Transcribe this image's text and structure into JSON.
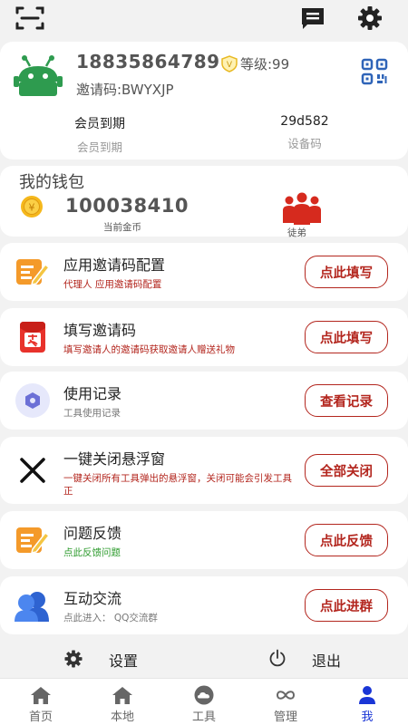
{
  "header": {
    "icons": [
      "scan-icon",
      "message-icon",
      "settings-icon"
    ]
  },
  "profile": {
    "phone": "18835864789",
    "level_badge": "V",
    "level": "等级:99",
    "invite_code": "邀请码:BWYXJP",
    "stats": [
      {
        "value": "会员到期",
        "label": "会员到期"
      },
      {
        "value": "29d582",
        "label": "设备码"
      }
    ]
  },
  "wallet": {
    "title": "我的钱包",
    "coin_symbol": "¥",
    "amount": "100038410",
    "amount_label": "当前金币",
    "people_label": "徒弟"
  },
  "items": [
    {
      "title": "应用邀请码配置",
      "subtitle": "代理人 应用邀请码配置",
      "button": "点此填写"
    },
    {
      "title": "填写邀请码",
      "subtitle": "填写邀请人的邀请码获取邀请人赠送礼物",
      "button": "点此填写"
    },
    {
      "title": "使用记录",
      "subtitle": "工具使用记录",
      "button": "查看记录"
    },
    {
      "title": "一键关闭悬浮窗",
      "subtitle": "一键关闭所有工具弹出的悬浮窗，关闭可能会引发工具正",
      "button": "全部关闭"
    },
    {
      "title": "问题反馈",
      "subtitle": "点此反馈问题",
      "button": "点此反馈"
    },
    {
      "title": "互动交流",
      "subtitle": "点此进入： QQ交流群",
      "button": "点此进群"
    }
  ],
  "footer": {
    "settings": "设置",
    "logout": "退出"
  },
  "tabs": [
    {
      "label": "首页",
      "icon": "home-icon"
    },
    {
      "label": "本地",
      "icon": "home-icon"
    },
    {
      "label": "工具",
      "icon": "cloud-icon"
    },
    {
      "label": "管理",
      "icon": "infinity-icon"
    },
    {
      "label": "我",
      "icon": "person-icon"
    }
  ],
  "colors": {
    "accent": "#b3261e",
    "active_tab": "#1a36d6",
    "robot": "#2e9b4f"
  }
}
